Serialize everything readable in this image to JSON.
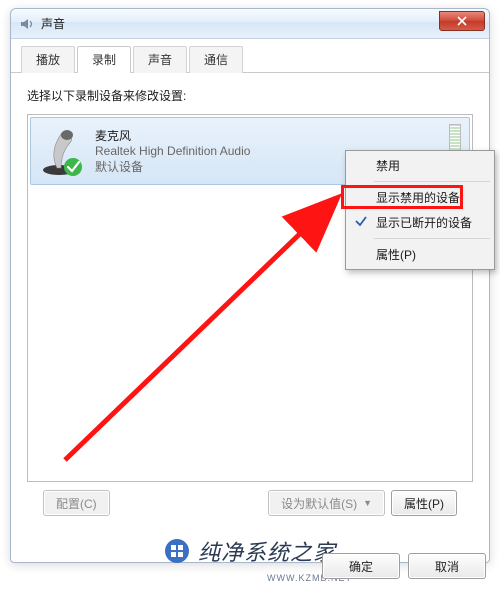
{
  "window": {
    "title": "声音"
  },
  "tabs": [
    {
      "label": "播放"
    },
    {
      "label": "录制",
      "active": true
    },
    {
      "label": "声音"
    },
    {
      "label": "通信"
    }
  ],
  "instruction": "选择以下录制设备来修改设置:",
  "device": {
    "name": "麦克风",
    "driver": "Realtek High Definition Audio",
    "status": "默认设备"
  },
  "context_menu": {
    "items": [
      {
        "label": "禁用",
        "kind": "item"
      },
      {
        "kind": "sep"
      },
      {
        "label": "显示禁用的设备",
        "kind": "item",
        "highlighted": true
      },
      {
        "label": "显示已断开的设备",
        "kind": "item",
        "checked": true
      },
      {
        "kind": "sep"
      },
      {
        "label": "属性(P)",
        "kind": "item"
      }
    ]
  },
  "buttons": {
    "configure": "配置(C)",
    "set_default": "设为默认值(S)",
    "properties": "属性(P)",
    "ok": "确定",
    "cancel": "取消"
  },
  "watermark": {
    "text": "纯净系统之家",
    "sub": "WWW.KZMB.NET"
  }
}
